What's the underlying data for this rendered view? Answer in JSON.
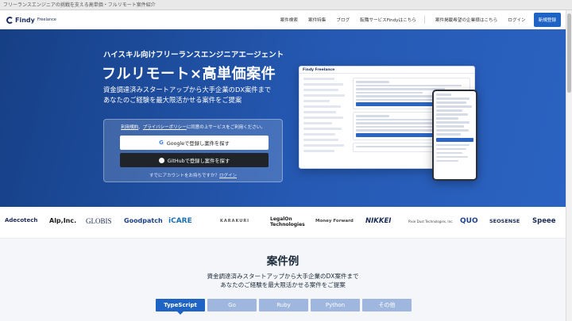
{
  "browser": {
    "tab_title": "フリーランスエンジニアの挑戦を支える高単価・フルリモート案件紹介"
  },
  "header": {
    "logo_text": "Findy",
    "logo_sub": "Freelance",
    "nav": [
      {
        "label": "案件検索"
      },
      {
        "label": "案件特集"
      },
      {
        "label": "ブログ"
      },
      {
        "label": "転職サービスFindyはこちら"
      },
      {
        "label": "案件掲載希望の企業様はこちら"
      },
      {
        "label": "ログイン"
      }
    ],
    "signup_label": "新規登録"
  },
  "hero": {
    "tagline": "ハイスキル向けフリーランスエンジニアエージェント",
    "title": "フルリモート×高単価案件",
    "desc_line1": "資金調達済みスタートアップから大手企業のDX案件まで",
    "desc_line2": "あなたのご経験を最大限活かせる案件をご提案",
    "terms_link1": "利用規約",
    "terms_sep": "、",
    "terms_link2": "プライバシーポリシー",
    "terms_suffix": "に同意の上サービスをご利用ください。",
    "google_label": "Googleで登録し案件を探す",
    "github_label": "GitHubで登録し案件を探す",
    "login_prompt": "すでにアカウントをお持ちですか？",
    "login_link": "ログイン",
    "mock_logo": "Findy Freelance"
  },
  "logos": [
    "Adecotech",
    "Alp,Inc.",
    "GLOBIS",
    "Goodpatch",
    "iCARE",
    "KARAKURI",
    "LegalOn Technologies",
    "Money Forward",
    "NIKKEI",
    "Pixie Dust Technologies, Inc.",
    "QUO",
    "SEOSENSE",
    "Speee"
  ],
  "cases": {
    "title": "案件例",
    "desc_line1": "資金調達済みスタートアップから大手企業のDX案件まで",
    "desc_line2": "あなたのご経験を最大限活かせる案件をご提案",
    "tabs": [
      {
        "label": "TypeScript"
      },
      {
        "label": "Go"
      },
      {
        "label": "Ruby"
      },
      {
        "label": "Python"
      },
      {
        "label": "その他"
      }
    ],
    "active_tab": "TypeScript"
  },
  "colors": {
    "brand_navy": "#1c2f62",
    "accent_blue": "#1f63c4",
    "tab_inactive": "#9fb7de"
  }
}
